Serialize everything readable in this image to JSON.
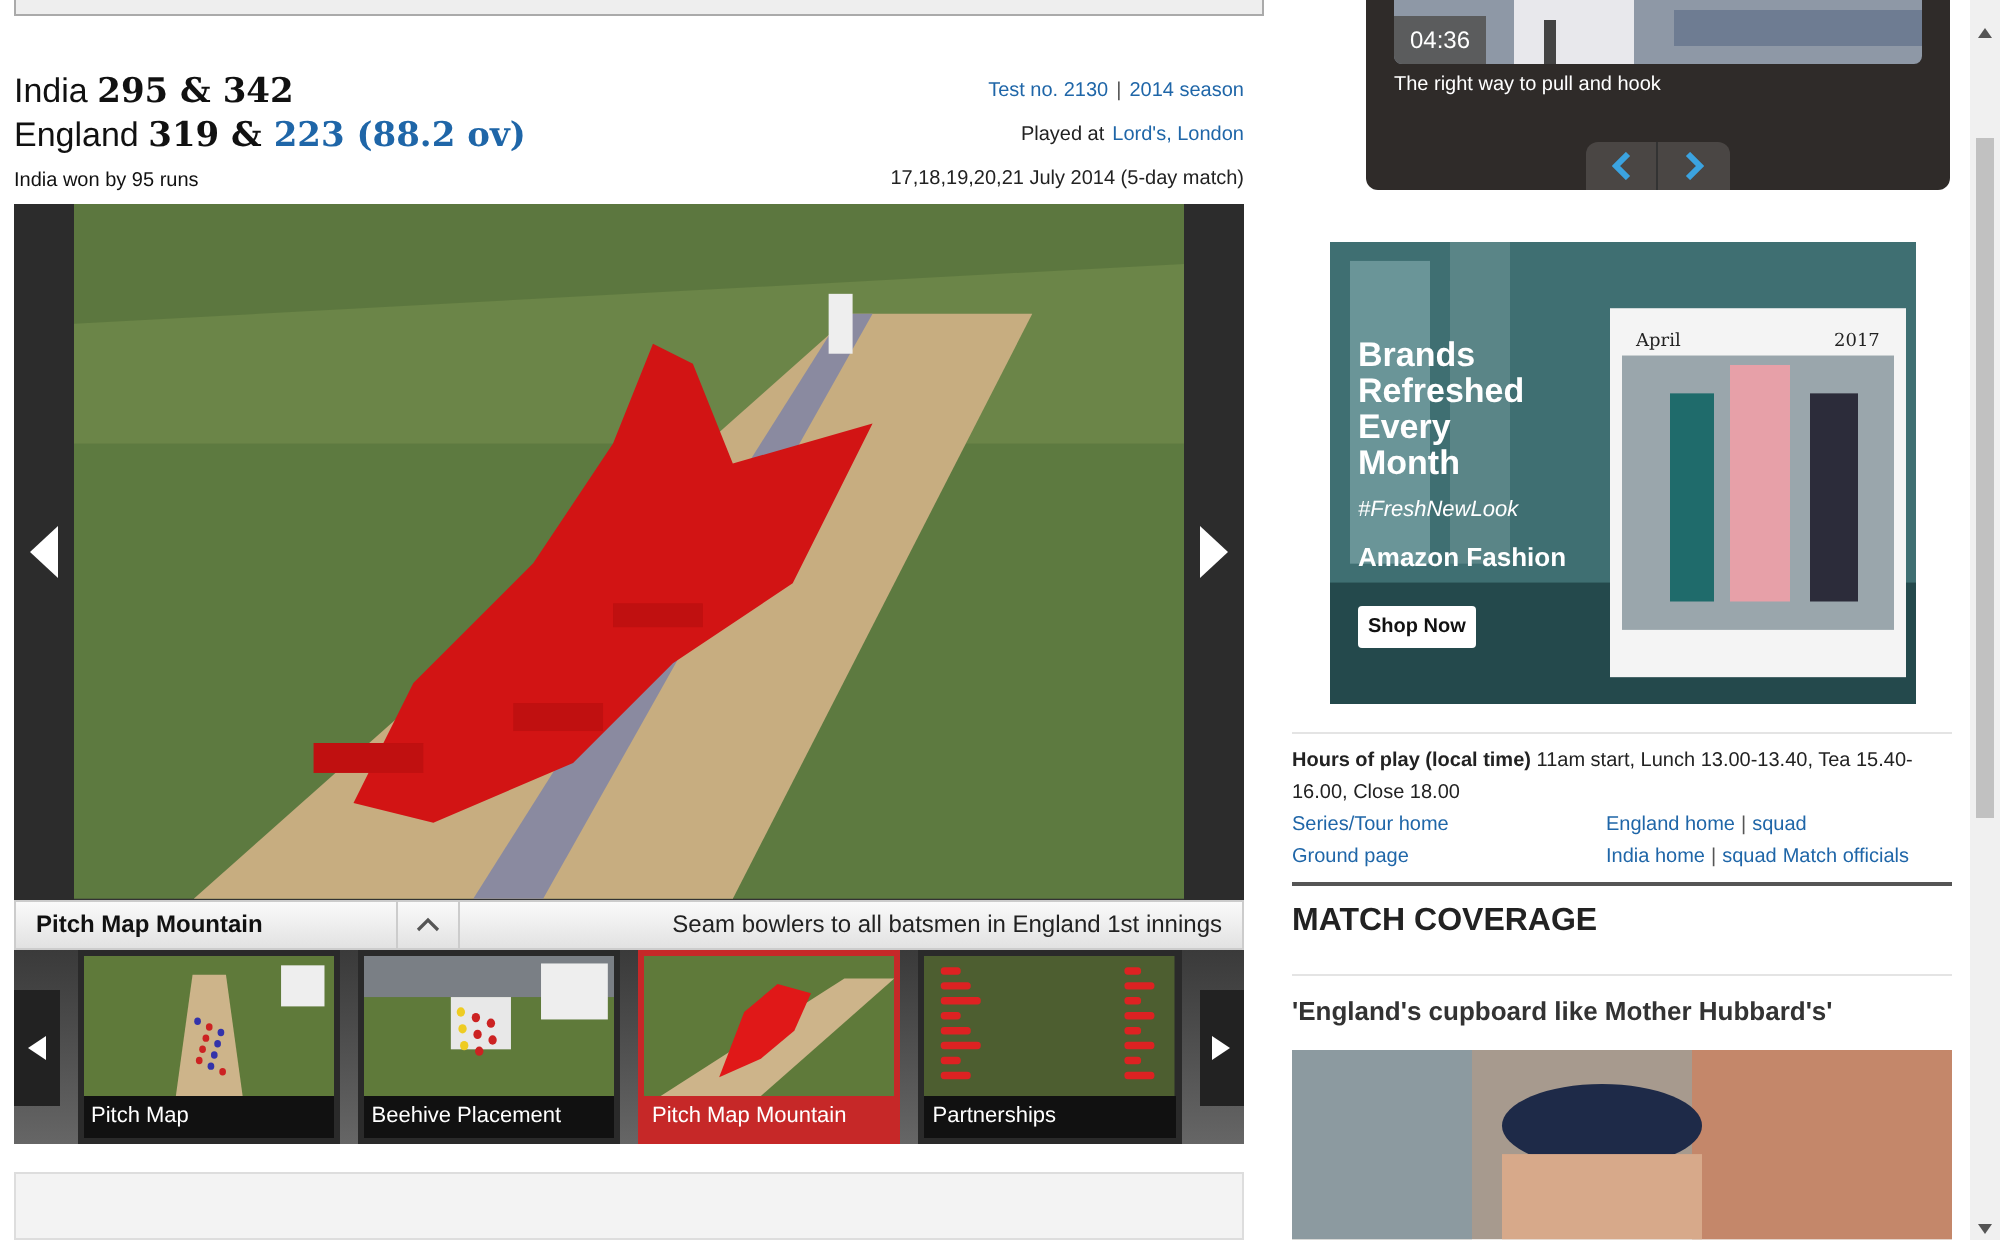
{
  "scorecard": {
    "team_1": {
      "name": "India",
      "innings": [
        {
          "score": "295",
          "live": false
        },
        {
          "score": "342",
          "live": false
        }
      ],
      "separator": "&"
    },
    "team_2": {
      "name": "England",
      "innings": [
        {
          "score": "319",
          "live": false
        },
        {
          "score": "223 (88.2 ov)",
          "live": true
        }
      ],
      "separator": "&"
    },
    "result": "India won by 95 runs",
    "test_no": "Test no. 2130",
    "link_separator": "|",
    "season": "2014 season",
    "played_at": "Played at",
    "venue": "Lord's, London",
    "dates": "17,18,19,20,21 July 2014 (5-day match)"
  },
  "viewer": {
    "title": "Pitch Map Mountain",
    "description": "Seam bowlers to all batsmen in England 1st innings",
    "thumbnails": [
      {
        "label": "Pitch Map",
        "selected": false,
        "kind": "pitch"
      },
      {
        "label": "Beehive Placement",
        "selected": false,
        "kind": "beehive"
      },
      {
        "label": "Pitch Map Mountain",
        "selected": true,
        "kind": "mountain"
      },
      {
        "label": "Partnerships",
        "selected": false,
        "kind": "partnerships"
      }
    ]
  },
  "video": {
    "duration": "04:36",
    "caption": "The right way to pull and hook"
  },
  "ad": {
    "headline": "Brands Refreshed Every Month",
    "hashtag": "#FreshNewLook",
    "brand": "Amazon Fashion",
    "button": "Shop Now",
    "month": "April",
    "year": "2017"
  },
  "match_info": {
    "hours_label": "Hours of play (local time)",
    "hours": "11am start, Lunch 13.00-13.40, Tea 15.40-16.00, Close 18.00",
    "link_separator": "|",
    "links": [
      [
        "Series/Tour home"
      ],
      [
        "England home",
        "squad"
      ],
      [
        "Ground page"
      ],
      [
        "India home",
        "squad",
        "Match officials"
      ]
    ]
  },
  "coverage": {
    "heading": "MATCH COVERAGE",
    "story": "'England's cupboard like Mother Hubbard's'"
  }
}
